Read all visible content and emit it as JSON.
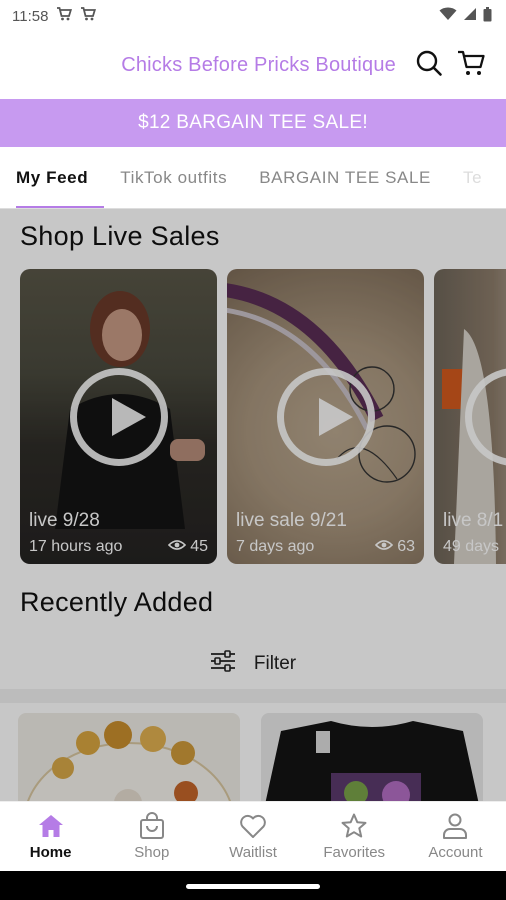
{
  "status_bar": {
    "time": "11:58"
  },
  "header": {
    "store_title": "Chicks Before Pricks Boutique"
  },
  "promo_banner": {
    "text": "$12 BARGAIN TEE SALE!"
  },
  "tabs": [
    {
      "label": "My Feed",
      "active": true
    },
    {
      "label": "TikTok outfits",
      "active": false
    },
    {
      "label": "BARGAIN TEE SALE",
      "active": false
    },
    {
      "label": "Te",
      "active": false
    }
  ],
  "live_sales": {
    "title": "Shop Live Sales",
    "cards": [
      {
        "title": "live 9/28",
        "time": "17 hours ago",
        "views": "45"
      },
      {
        "title": "live sale 9/21",
        "time": "7 days ago",
        "views": "63"
      },
      {
        "title": "live 8/1",
        "time": "49 days",
        "views": ""
      }
    ]
  },
  "recently_added": {
    "title": "Recently Added",
    "filter_label": "Filter"
  },
  "bottom_nav": [
    {
      "label": "Home",
      "icon": "home-icon",
      "active": true
    },
    {
      "label": "Shop",
      "icon": "shopping-bag-icon",
      "active": false
    },
    {
      "label": "Waitlist",
      "icon": "heart-icon",
      "active": false
    },
    {
      "label": "Favorites",
      "icon": "star-icon",
      "active": false
    },
    {
      "label": "Account",
      "icon": "person-icon",
      "active": false
    }
  ],
  "colors": {
    "brand": "#b57ce6",
    "banner": "#c79af0"
  }
}
